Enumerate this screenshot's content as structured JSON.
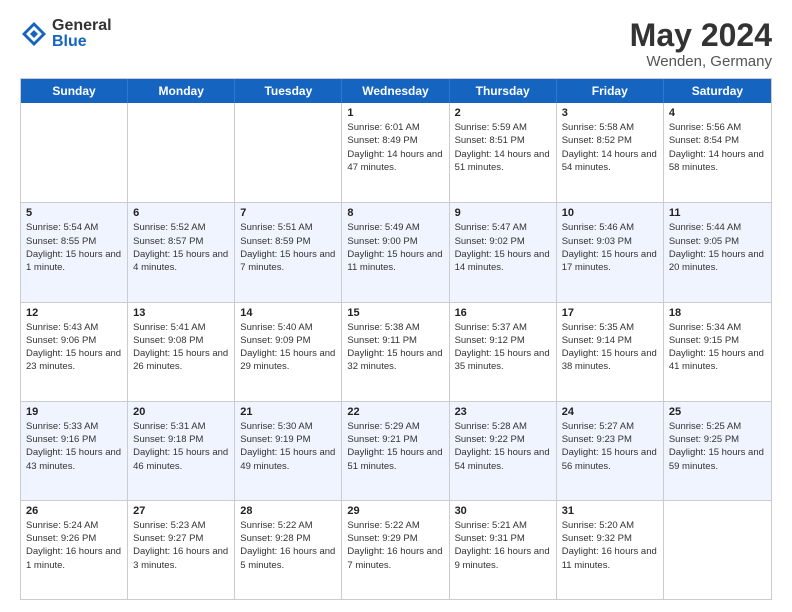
{
  "logo": {
    "general": "General",
    "blue": "Blue"
  },
  "title": {
    "month": "May 2024",
    "location": "Wenden, Germany"
  },
  "header_days": [
    "Sunday",
    "Monday",
    "Tuesday",
    "Wednesday",
    "Thursday",
    "Friday",
    "Saturday"
  ],
  "rows": [
    {
      "alt": false,
      "cells": [
        {
          "day": "",
          "info": ""
        },
        {
          "day": "",
          "info": ""
        },
        {
          "day": "",
          "info": ""
        },
        {
          "day": "1",
          "info": "Sunrise: 6:01 AM\nSunset: 8:49 PM\nDaylight: 14 hours\nand 47 minutes."
        },
        {
          "day": "2",
          "info": "Sunrise: 5:59 AM\nSunset: 8:51 PM\nDaylight: 14 hours\nand 51 minutes."
        },
        {
          "day": "3",
          "info": "Sunrise: 5:58 AM\nSunset: 8:52 PM\nDaylight: 14 hours\nand 54 minutes."
        },
        {
          "day": "4",
          "info": "Sunrise: 5:56 AM\nSunset: 8:54 PM\nDaylight: 14 hours\nand 58 minutes."
        }
      ]
    },
    {
      "alt": true,
      "cells": [
        {
          "day": "5",
          "info": "Sunrise: 5:54 AM\nSunset: 8:55 PM\nDaylight: 15 hours\nand 1 minute."
        },
        {
          "day": "6",
          "info": "Sunrise: 5:52 AM\nSunset: 8:57 PM\nDaylight: 15 hours\nand 4 minutes."
        },
        {
          "day": "7",
          "info": "Sunrise: 5:51 AM\nSunset: 8:59 PM\nDaylight: 15 hours\nand 7 minutes."
        },
        {
          "day": "8",
          "info": "Sunrise: 5:49 AM\nSunset: 9:00 PM\nDaylight: 15 hours\nand 11 minutes."
        },
        {
          "day": "9",
          "info": "Sunrise: 5:47 AM\nSunset: 9:02 PM\nDaylight: 15 hours\nand 14 minutes."
        },
        {
          "day": "10",
          "info": "Sunrise: 5:46 AM\nSunset: 9:03 PM\nDaylight: 15 hours\nand 17 minutes."
        },
        {
          "day": "11",
          "info": "Sunrise: 5:44 AM\nSunset: 9:05 PM\nDaylight: 15 hours\nand 20 minutes."
        }
      ]
    },
    {
      "alt": false,
      "cells": [
        {
          "day": "12",
          "info": "Sunrise: 5:43 AM\nSunset: 9:06 PM\nDaylight: 15 hours\nand 23 minutes."
        },
        {
          "day": "13",
          "info": "Sunrise: 5:41 AM\nSunset: 9:08 PM\nDaylight: 15 hours\nand 26 minutes."
        },
        {
          "day": "14",
          "info": "Sunrise: 5:40 AM\nSunset: 9:09 PM\nDaylight: 15 hours\nand 29 minutes."
        },
        {
          "day": "15",
          "info": "Sunrise: 5:38 AM\nSunset: 9:11 PM\nDaylight: 15 hours\nand 32 minutes."
        },
        {
          "day": "16",
          "info": "Sunrise: 5:37 AM\nSunset: 9:12 PM\nDaylight: 15 hours\nand 35 minutes."
        },
        {
          "day": "17",
          "info": "Sunrise: 5:35 AM\nSunset: 9:14 PM\nDaylight: 15 hours\nand 38 minutes."
        },
        {
          "day": "18",
          "info": "Sunrise: 5:34 AM\nSunset: 9:15 PM\nDaylight: 15 hours\nand 41 minutes."
        }
      ]
    },
    {
      "alt": true,
      "cells": [
        {
          "day": "19",
          "info": "Sunrise: 5:33 AM\nSunset: 9:16 PM\nDaylight: 15 hours\nand 43 minutes."
        },
        {
          "day": "20",
          "info": "Sunrise: 5:31 AM\nSunset: 9:18 PM\nDaylight: 15 hours\nand 46 minutes."
        },
        {
          "day": "21",
          "info": "Sunrise: 5:30 AM\nSunset: 9:19 PM\nDaylight: 15 hours\nand 49 minutes."
        },
        {
          "day": "22",
          "info": "Sunrise: 5:29 AM\nSunset: 9:21 PM\nDaylight: 15 hours\nand 51 minutes."
        },
        {
          "day": "23",
          "info": "Sunrise: 5:28 AM\nSunset: 9:22 PM\nDaylight: 15 hours\nand 54 minutes."
        },
        {
          "day": "24",
          "info": "Sunrise: 5:27 AM\nSunset: 9:23 PM\nDaylight: 15 hours\nand 56 minutes."
        },
        {
          "day": "25",
          "info": "Sunrise: 5:25 AM\nSunset: 9:25 PM\nDaylight: 15 hours\nand 59 minutes."
        }
      ]
    },
    {
      "alt": false,
      "cells": [
        {
          "day": "26",
          "info": "Sunrise: 5:24 AM\nSunset: 9:26 PM\nDaylight: 16 hours\nand 1 minute."
        },
        {
          "day": "27",
          "info": "Sunrise: 5:23 AM\nSunset: 9:27 PM\nDaylight: 16 hours\nand 3 minutes."
        },
        {
          "day": "28",
          "info": "Sunrise: 5:22 AM\nSunset: 9:28 PM\nDaylight: 16 hours\nand 5 minutes."
        },
        {
          "day": "29",
          "info": "Sunrise: 5:22 AM\nSunset: 9:29 PM\nDaylight: 16 hours\nand 7 minutes."
        },
        {
          "day": "30",
          "info": "Sunrise: 5:21 AM\nSunset: 9:31 PM\nDaylight: 16 hours\nand 9 minutes."
        },
        {
          "day": "31",
          "info": "Sunrise: 5:20 AM\nSunset: 9:32 PM\nDaylight: 16 hours\nand 11 minutes."
        },
        {
          "day": "",
          "info": ""
        }
      ]
    }
  ]
}
